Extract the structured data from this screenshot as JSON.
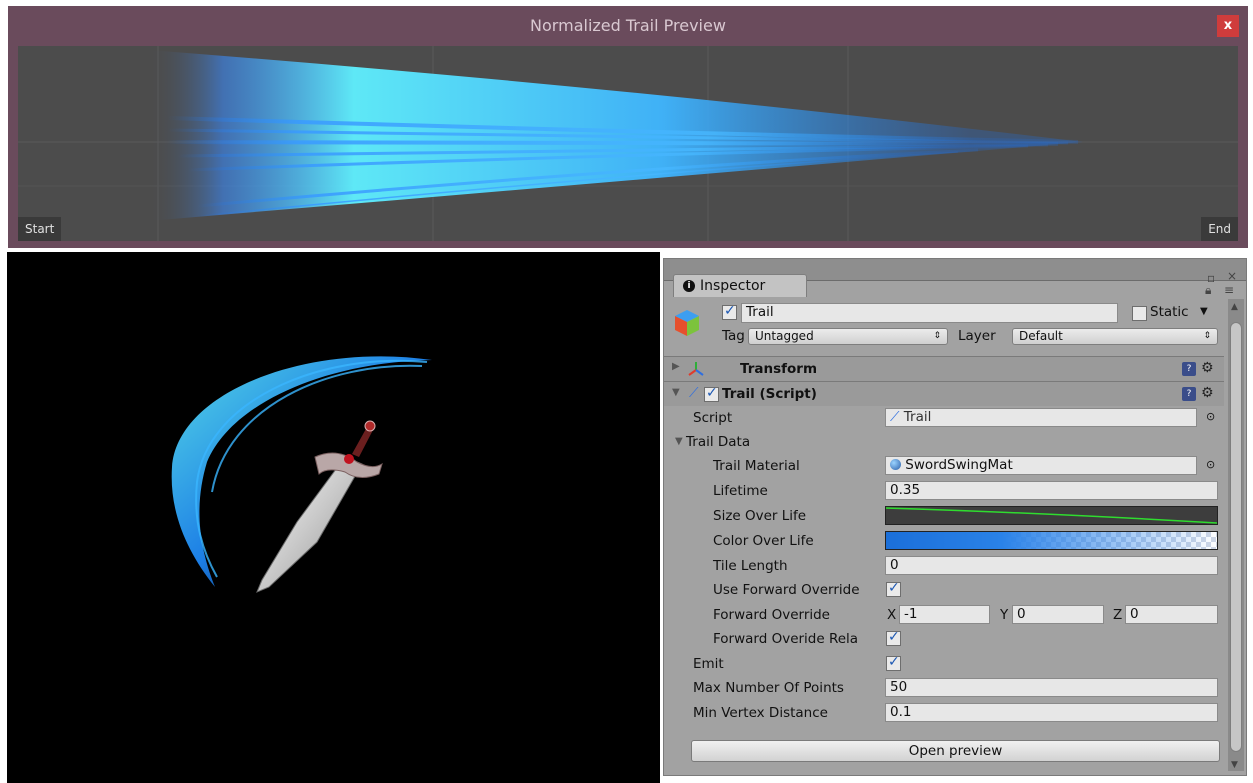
{
  "preview": {
    "title": "Normalized Trail Preview",
    "close_label": "x",
    "start_label": "Start",
    "end_label": "End"
  },
  "inspector": {
    "tab_label": "Inspector",
    "object": {
      "name": "Trail",
      "active": true,
      "static_label": "Static",
      "static_checked": false,
      "tag_label": "Tag",
      "tag_value": "Untagged",
      "layer_label": "Layer",
      "layer_value": "Default"
    },
    "components": {
      "transform_title": "Transform",
      "trail_title": "Trail (Script)"
    },
    "fields": {
      "script_label": "Script",
      "script_value": "Trail",
      "trail_data_label": "Trail Data",
      "trail_material_label": "Trail Material",
      "trail_material_value": "SwordSwingMat",
      "lifetime_label": "Lifetime",
      "lifetime_value": "0.35",
      "size_over_life_label": "Size Over Life",
      "color_over_life_label": "Color Over Life",
      "tile_length_label": "Tile Length",
      "tile_length_value": "0",
      "use_forward_override_label": "Use Forward Override",
      "use_forward_override_checked": true,
      "forward_override_label": "Forward Override",
      "x_label": "X",
      "x_value": "-1",
      "y_label": "Y",
      "y_value": "0",
      "z_label": "Z",
      "z_value": "0",
      "forward_override_relative_label": "Forward Overide Rela",
      "forward_override_relative_checked": true,
      "emit_label": "Emit",
      "emit_checked": true,
      "max_points_label": "Max Number Of Points",
      "max_points_value": "50",
      "min_vertex_label": "Min Vertex Distance",
      "min_vertex_value": "0.1"
    },
    "open_preview_label": "Open preview"
  },
  "colors": {
    "preview_frame": "#6a4b5c",
    "trail_cyan": "#5ff0ff",
    "trail_blue": "#1f6fe0",
    "checkbox_blue": "#1d58b3"
  }
}
